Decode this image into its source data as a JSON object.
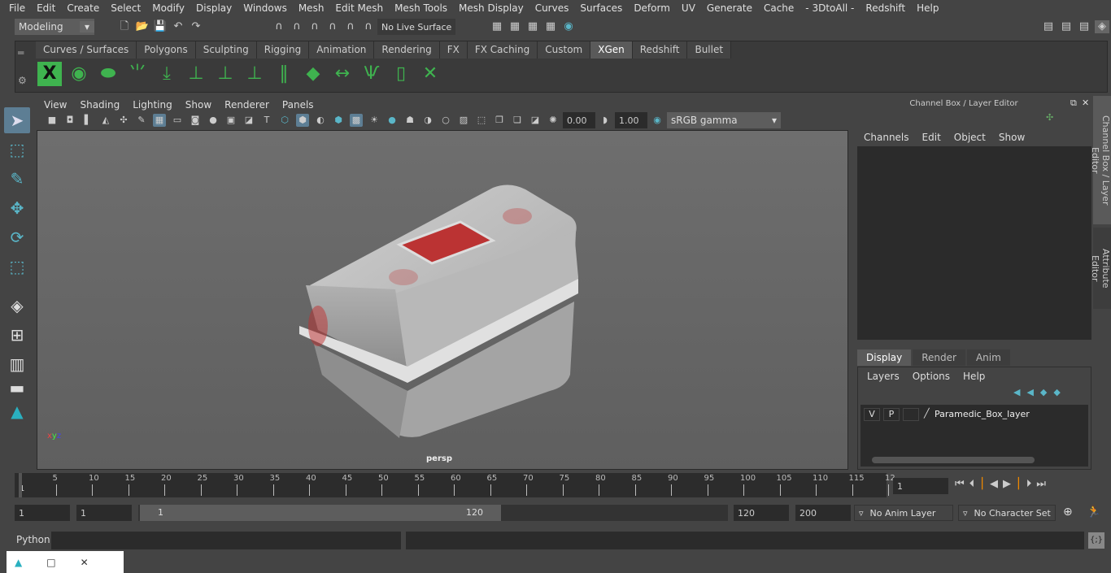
{
  "menu": [
    "File",
    "Edit",
    "Create",
    "Select",
    "Modify",
    "Display",
    "Windows",
    "Mesh",
    "Edit Mesh",
    "Mesh Tools",
    "Mesh Display",
    "Curves",
    "Surfaces",
    "Deform",
    "UV",
    "Generate",
    "Cache",
    "- 3DtoAll -",
    "Redshift",
    "Help"
  ],
  "status": {
    "mode": "Modeling",
    "live_surface": "No Live Surface"
  },
  "shelf": {
    "tabs": [
      "Curves / Surfaces",
      "Polygons",
      "Sculpting",
      "Rigging",
      "Animation",
      "Rendering",
      "FX",
      "FX Caching",
      "Custom",
      "XGen",
      "Redshift",
      "Bullet"
    ],
    "active": "XGen"
  },
  "panel": {
    "menu": [
      "View",
      "Shading",
      "Lighting",
      "Show",
      "Renderer",
      "Panels"
    ],
    "exposure": "0.00",
    "gamma": "1.00",
    "color_space": "sRGB gamma",
    "camera": "persp"
  },
  "channel_box": {
    "title": "Channel Box / Layer Editor",
    "menu": [
      "Channels",
      "Edit",
      "Object",
      "Show"
    ],
    "layer_tabs": [
      "Display",
      "Render",
      "Anim"
    ],
    "active_layer_tab": "Display",
    "layer_menu": [
      "Layers",
      "Options",
      "Help"
    ],
    "layer": {
      "v": "V",
      "p": "P",
      "name": "Paramedic_Box_layer"
    }
  },
  "side_tabs": [
    "Channel Box / Layer Editor",
    "Attribute Editor"
  ],
  "timeline": {
    "ticks": [
      "5",
      "10",
      "15",
      "20",
      "25",
      "30",
      "35",
      "40",
      "45",
      "50",
      "55",
      "60",
      "65",
      "70",
      "75",
      "80",
      "85",
      "90",
      "95",
      "100",
      "105",
      "110",
      "115",
      "12"
    ],
    "start_label": "1",
    "current_frame": "1"
  },
  "range": {
    "start": "1",
    "playback_start": "1",
    "slider_start": "1",
    "slider_end": "120",
    "playback_end": "120",
    "end": "200",
    "anim_layer": "No Anim Layer",
    "character_set": "No Character Set"
  },
  "command": {
    "language": "Python"
  }
}
